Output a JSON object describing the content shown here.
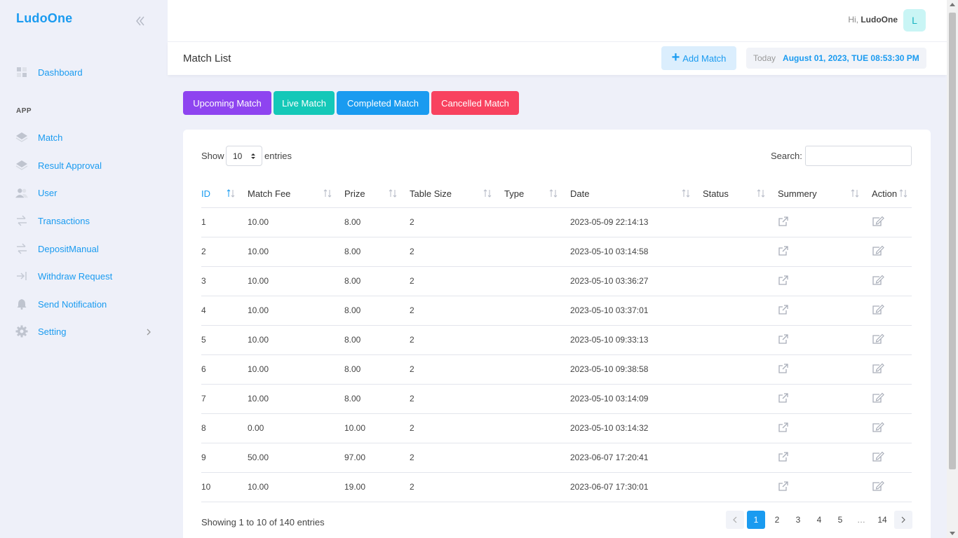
{
  "brand": "LudoOne",
  "sidebar": {
    "dashboard": "Dashboard",
    "section": "APP",
    "items": [
      {
        "label": "Match",
        "icon": "diamond-icon"
      },
      {
        "label": "Result Approval",
        "icon": "diamond-icon"
      },
      {
        "label": "User",
        "icon": "users-icon"
      },
      {
        "label": "Transactions",
        "icon": "transfer-icon"
      },
      {
        "label": "DepositManual",
        "icon": "transfer-icon"
      },
      {
        "label": "Withdraw Request",
        "icon": "withdraw-icon"
      },
      {
        "label": "Send Notification",
        "icon": "bell-icon"
      },
      {
        "label": "Setting",
        "icon": "gear-icon"
      }
    ]
  },
  "header": {
    "greeting": "Hi,",
    "username": "LudoOne",
    "avatar_letter": "L"
  },
  "titlebar": {
    "title": "Match List",
    "add_label": "Add Match",
    "today_label": "Today",
    "datetime": "August 01, 2023, TUE 08:53:30 PM"
  },
  "tabs": [
    {
      "label": "Upcoming Match",
      "color": "#8e44f0"
    },
    {
      "label": "Live Match",
      "color": "#14c8b8"
    },
    {
      "label": "Completed Match",
      "color": "#1a9bf0"
    },
    {
      "label": "Cancelled Match",
      "color": "#f8425f"
    }
  ],
  "table": {
    "show_label": "Show",
    "entries_value": "10",
    "entries_label": "entries",
    "search_label": "Search:",
    "columns": [
      "ID",
      "Match Fee",
      "Prize",
      "Table Size",
      "Type",
      "Date",
      "Status",
      "Summery",
      "Action"
    ],
    "rows": [
      {
        "id": "1",
        "fee": "10.00",
        "prize": "8.00",
        "size": "2",
        "type": "",
        "date": "2023-05-09 22:14:13",
        "status": ""
      },
      {
        "id": "2",
        "fee": "10.00",
        "prize": "8.00",
        "size": "2",
        "type": "",
        "date": "2023-05-10 03:14:58",
        "status": ""
      },
      {
        "id": "3",
        "fee": "10.00",
        "prize": "8.00",
        "size": "2",
        "type": "",
        "date": "2023-05-10 03:36:27",
        "status": ""
      },
      {
        "id": "4",
        "fee": "10.00",
        "prize": "8.00",
        "size": "2",
        "type": "",
        "date": "2023-05-10 03:37:01",
        "status": ""
      },
      {
        "id": "5",
        "fee": "10.00",
        "prize": "8.00",
        "size": "2",
        "type": "",
        "date": "2023-05-10 09:33:13",
        "status": ""
      },
      {
        "id": "6",
        "fee": "10.00",
        "prize": "8.00",
        "size": "2",
        "type": "",
        "date": "2023-05-10 09:38:58",
        "status": ""
      },
      {
        "id": "7",
        "fee": "10.00",
        "prize": "8.00",
        "size": "2",
        "type": "",
        "date": "2023-05-10 03:14:09",
        "status": ""
      },
      {
        "id": "8",
        "fee": "0.00",
        "prize": "10.00",
        "size": "2",
        "type": "",
        "date": "2023-05-10 03:14:32",
        "status": ""
      },
      {
        "id": "9",
        "fee": "50.00",
        "prize": "97.00",
        "size": "2",
        "type": "",
        "date": "2023-06-07 17:20:41",
        "status": ""
      },
      {
        "id": "10",
        "fee": "10.00",
        "prize": "19.00",
        "size": "2",
        "type": "",
        "date": "2023-06-07 17:30:01",
        "status": ""
      }
    ],
    "info": "Showing 1 to 10 of 140 entries",
    "pages": [
      "1",
      "2",
      "3",
      "4",
      "5",
      "…",
      "14"
    ]
  }
}
